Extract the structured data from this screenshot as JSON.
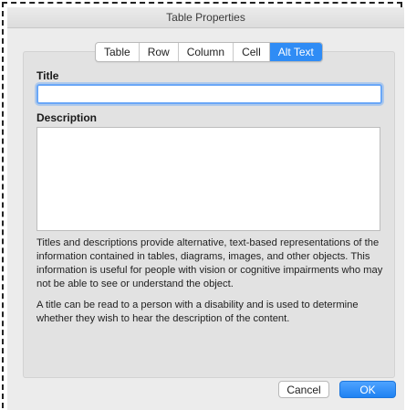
{
  "window": {
    "title": "Table Properties"
  },
  "tabs": [
    {
      "label": "Table",
      "active": false
    },
    {
      "label": "Row",
      "active": false
    },
    {
      "label": "Column",
      "active": false
    },
    {
      "label": "Cell",
      "active": false
    },
    {
      "label": "Alt Text",
      "active": true
    }
  ],
  "form": {
    "title_label": "Title",
    "title_value": "",
    "description_label": "Description",
    "description_value": ""
  },
  "help": {
    "paragraph1": "Titles and descriptions provide alternative, text-based representations of the information contained in tables, diagrams, images, and other objects. This information is useful for people with vision or cognitive impairments who may not be able to see or understand the object.",
    "paragraph2": "A title can be read to a person with a disability and is used to determine whether they wish to hear the description of the content."
  },
  "buttons": {
    "cancel": "Cancel",
    "ok": "OK"
  },
  "colors": {
    "accent": "#2f8cf5",
    "focus_ring": "#6aa7f7"
  }
}
